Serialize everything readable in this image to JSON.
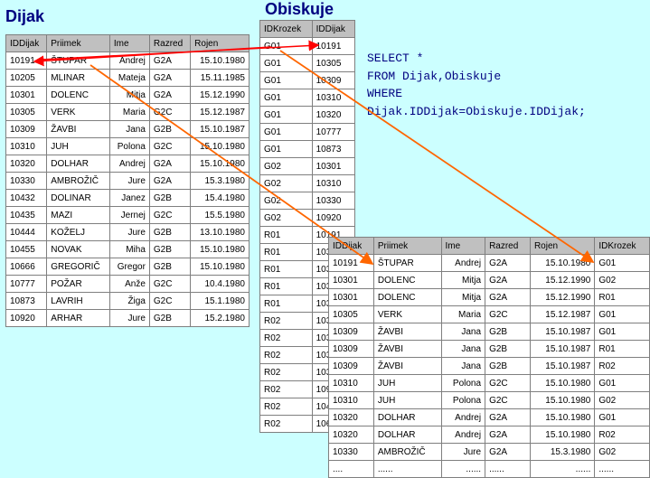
{
  "titles": {
    "dijak": "Dijak",
    "obiskuje": "Obiskuje"
  },
  "dijak": {
    "headers": [
      "IDDijak",
      "Priimek",
      "Ime",
      "Razred",
      "Rojen"
    ],
    "rows": [
      [
        "10191",
        "ŠTUPAR",
        "Andrej",
        "G2A",
        "15.10.1980"
      ],
      [
        "10205",
        "MLINAR",
        "Mateja",
        "G2A",
        "15.11.1985"
      ],
      [
        "10301",
        "DOLENC",
        "Mitja",
        "G2A",
        "15.12.1990"
      ],
      [
        "10305",
        "VERK",
        "Maria",
        "G2C",
        "15.12.1987"
      ],
      [
        "10309",
        "ŽAVBI",
        "Jana",
        "G2B",
        "15.10.1987"
      ],
      [
        "10310",
        "JUH",
        "Polona",
        "G2C",
        "15.10.1980"
      ],
      [
        "10320",
        "DOLHAR",
        "Andrej",
        "G2A",
        "15.10.1980"
      ],
      [
        "10330",
        "AMBROŽIČ",
        "Jure",
        "G2A",
        "15.3.1980"
      ],
      [
        "10432",
        "DOLINAR",
        "Janez",
        "G2B",
        "15.4.1980"
      ],
      [
        "10435",
        "MAZI",
        "Jernej",
        "G2C",
        "15.5.1980"
      ],
      [
        "10444",
        "KOŽELJ",
        "Jure",
        "G2B",
        "13.10.1980"
      ],
      [
        "10455",
        "NOVAK",
        "Miha",
        "G2B",
        "15.10.1980"
      ],
      [
        "10666",
        "GREGORIČ",
        "Gregor",
        "G2B",
        "15.10.1980"
      ],
      [
        "10777",
        "POŽAR",
        "Anže",
        "G2C",
        "10.4.1980"
      ],
      [
        "10873",
        "LAVRIH",
        "Žiga",
        "G2C",
        "15.1.1980"
      ],
      [
        "10920",
        "ARHAR",
        "Jure",
        "G2B",
        "15.2.1980"
      ]
    ]
  },
  "obiskuje": {
    "headers": [
      "IDKrozek",
      "IDDijak"
    ],
    "rows": [
      [
        "G01",
        "10191"
      ],
      [
        "G01",
        "10305"
      ],
      [
        "G01",
        "10309"
      ],
      [
        "G01",
        "10310"
      ],
      [
        "G01",
        "10320"
      ],
      [
        "G01",
        "10777"
      ],
      [
        "G01",
        "10873"
      ],
      [
        "G02",
        "10301"
      ],
      [
        "G02",
        "10310"
      ],
      [
        "G02",
        "10330"
      ],
      [
        "G02",
        "10920"
      ],
      [
        "R01",
        "10191"
      ],
      [
        "R01",
        "10301"
      ],
      [
        "R01",
        "10309"
      ],
      [
        "R01",
        "10320"
      ],
      [
        "R01",
        "10330"
      ],
      [
        "R02",
        "10320"
      ],
      [
        "R02",
        "10309"
      ],
      [
        "R02",
        "10320"
      ],
      [
        "R02",
        "10330"
      ],
      [
        "R02",
        "10920"
      ],
      [
        "R02",
        "10455"
      ],
      [
        "R02",
        "10666"
      ]
    ]
  },
  "sql": "SELECT *\nFROM Dijak,Obiskuje\nWHERE\nDijak.IDDijak=Obiskuje.IDDijak;",
  "result": {
    "headers": [
      "IDDijak",
      "Priimek",
      "Ime",
      "Razred",
      "Rojen",
      "IDKrozek"
    ],
    "rows": [
      [
        "10191",
        "ŠTUPAR",
        "Andrej",
        "G2A",
        "15.10.1980",
        "G01"
      ],
      [
        "10301",
        "DOLENC",
        "Mitja",
        "G2A",
        "15.12.1990",
        "G02"
      ],
      [
        "10301",
        "DOLENC",
        "Mitja",
        "G2A",
        "15.12.1990",
        "R01"
      ],
      [
        "10305",
        "VERK",
        "Maria",
        "G2C",
        "15.12.1987",
        "G01"
      ],
      [
        "10309",
        "ŽAVBI",
        "Jana",
        "G2B",
        "15.10.1987",
        "G01"
      ],
      [
        "10309",
        "ŽAVBI",
        "Jana",
        "G2B",
        "15.10.1987",
        "R01"
      ],
      [
        "10309",
        "ŽAVBI",
        "Jana",
        "G2B",
        "15.10.1987",
        "R02"
      ],
      [
        "10310",
        "JUH",
        "Polona",
        "G2C",
        "15.10.1980",
        "G01"
      ],
      [
        "10310",
        "JUH",
        "Polona",
        "G2C",
        "15.10.1980",
        "G02"
      ],
      [
        "10320",
        "DOLHAR",
        "Andrej",
        "G2A",
        "15.10.1980",
        "G01"
      ],
      [
        "10320",
        "DOLHAR",
        "Andrej",
        "G2A",
        "15.10.1980",
        "R02"
      ],
      [
        "10330",
        "AMBROŽIČ",
        "Jure",
        "G2A",
        "15.3.1980",
        "G02"
      ],
      [
        "....",
        "......",
        "......",
        "......",
        "......",
        "......"
      ]
    ]
  },
  "colors": {
    "arrow": "#ff6600",
    "arrow_red": "#ff0000",
    "title": "#000080",
    "background": "#ccffff"
  }
}
